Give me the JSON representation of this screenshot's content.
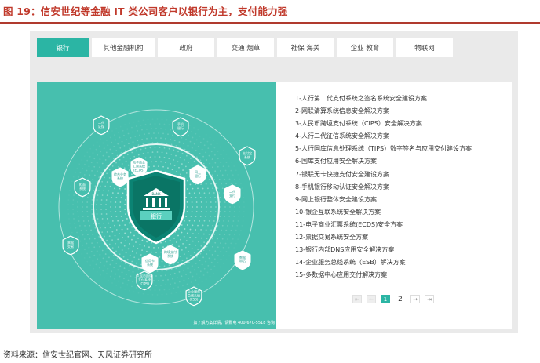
{
  "figure_title": "图 19：信安世纪等金融 IT 类公司客户以银行为主，支付能力强",
  "tabs": [
    {
      "label": "银行",
      "active": true
    },
    {
      "label": "其他金融机构",
      "active": false
    },
    {
      "label": "政府",
      "active": false
    },
    {
      "label": "交通 烟草",
      "active": false
    },
    {
      "label": "社保 海关",
      "active": false
    },
    {
      "label": "企业 教育",
      "active": false
    },
    {
      "label": "物联网",
      "active": false
    }
  ],
  "graphic": {
    "center_shield_top": "BANK",
    "center_label": "银行",
    "footer_note": "如了解方案详情，请致电 400-670-5518 咨询",
    "nodes": [
      {
        "lines": [
          "二代",
          "证保"
        ]
      },
      {
        "lines": [
          "手机",
          "银行"
        ]
      },
      {
        "lines": [
          "支付宝",
          "系统"
        ]
      },
      {
        "lines": [
          "电子商业",
          "汇票系统",
          "(ECDS)"
        ]
      },
      {
        "lines": [
          "综合业务",
          "系统"
        ]
      },
      {
        "lines": [
          "网上",
          "银行"
        ]
      },
      {
        "lines": [
          "柜面",
          "系统"
        ]
      },
      {
        "lines": [
          "二代",
          "支付"
        ]
      },
      {
        "lines": [
          "跨境支付",
          "系统"
        ]
      },
      {
        "lines": [
          "信用卡",
          "系统"
        ]
      },
      {
        "lines": [
          "数据",
          "中心"
        ]
      },
      {
        "lines": [
          "票据",
          "交易"
        ]
      },
      {
        "lines": [
          "人民币跨境",
          "支付系统",
          "(CIPS)"
        ]
      },
      {
        "lines": [
          "企业服务",
          "总线系统",
          "(ESB)"
        ]
      }
    ]
  },
  "solutions": [
    "1-人行第二代支付系统之签名系统安全建设方案",
    "2-网联清算系统信息安全解决方案",
    "3-人民币跨境支付系统（CIPS）安全解决方案",
    "4-人行二代征信系统安全解决方案",
    "5-人行国库信息处理系统（TIPS）数字签名与应用交付建设方案",
    "6-国库支付应用安全解决方案",
    "7-银联无卡快捷支付安全建设方案",
    "8-手机银行移动认证安全解决方案",
    "9-网上银行整体安全建设方案",
    "10-银企互联系统安全解决方案",
    "11-电子商业汇票系统(ECDS)安全方案",
    "12-票据交易系统安全方案",
    "13-银行内部DNS应用安全解决方案",
    "14-企业服务总线系统（ESB）解决方案",
    "15-多数据中心应用交付解决方案"
  ],
  "pagination": {
    "first": "⇤",
    "prev": "←",
    "current": "1",
    "next_page": "2",
    "next": "→",
    "last": "⇥"
  },
  "source": "资料来源：信安世纪官网、天风证券研究所"
}
